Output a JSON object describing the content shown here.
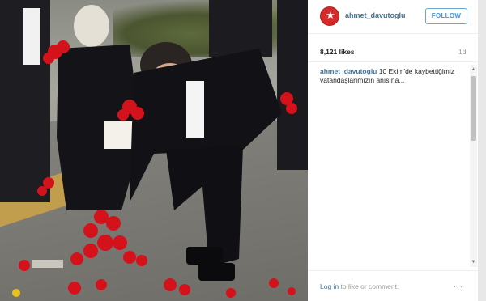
{
  "post": {
    "username": "ahmet_davutoglu",
    "follow_label": "FOLLOW",
    "likes": "8,121 likes",
    "age": "1d",
    "caption_author": "ahmet_davutoglu",
    "caption_text": " 10 Ekim'de kaybettiğimiz vatandaşlarımızın anısına..."
  },
  "footer": {
    "login_link": "Log in",
    "login_rest": " to like or comment.",
    "more": "···"
  },
  "icons": {
    "avatar": "avatar-image",
    "more": "more-options-icon"
  },
  "colors": {
    "username": "#3f729b",
    "follow_border": "#70a3c9",
    "follow_text": "#3897f0",
    "muted": "#999999"
  }
}
